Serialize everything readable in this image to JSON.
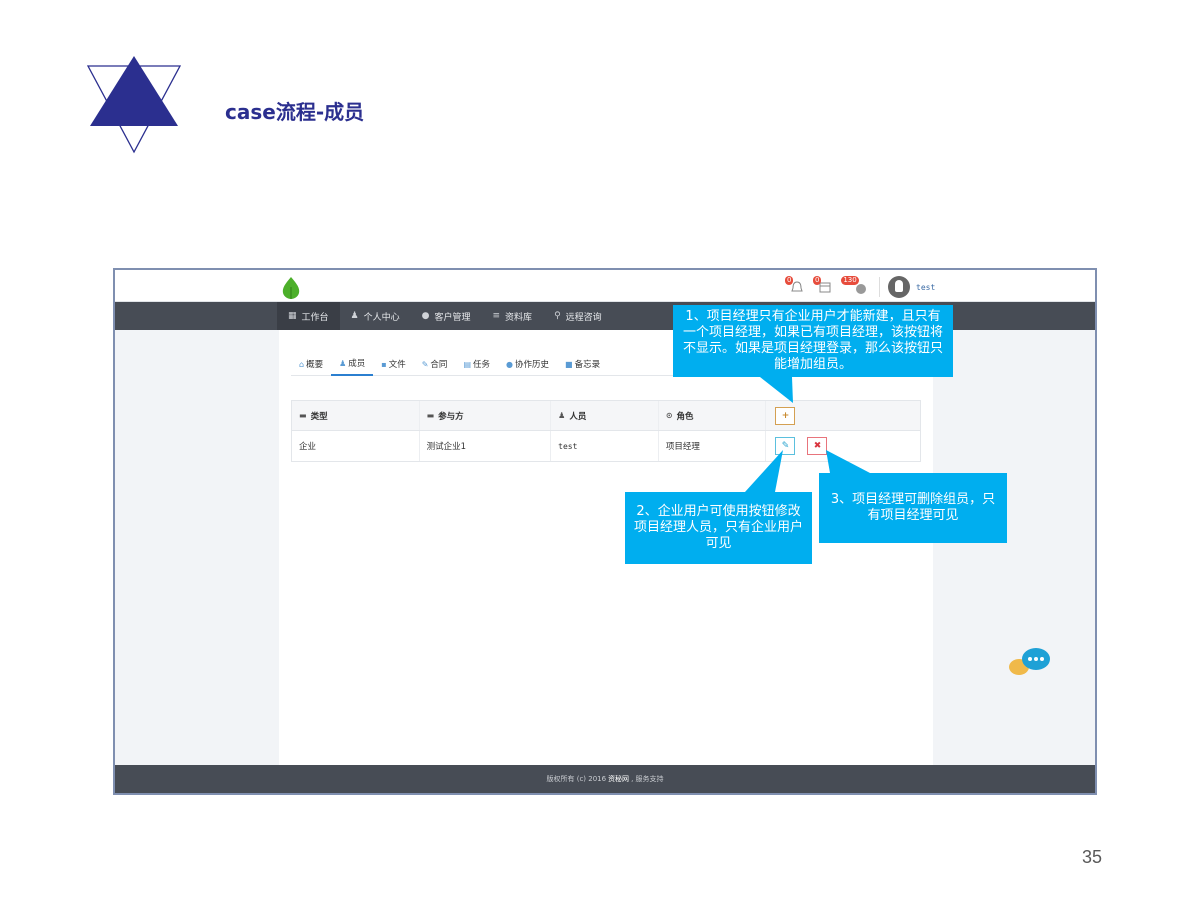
{
  "slide": {
    "title": "case流程-成员",
    "page_number": "35",
    "accent_color": "#2b2f8f"
  },
  "app": {
    "badges": {
      "notifications": "0",
      "tasks": "0",
      "messages": "130"
    },
    "username": "test",
    "nav": [
      {
        "label": "工作台",
        "icon": "grid-icon"
      },
      {
        "label": "个人中心",
        "icon": "user-icon"
      },
      {
        "label": "客户管理",
        "icon": "chat-icon"
      },
      {
        "label": "资料库",
        "icon": "database-icon"
      },
      {
        "label": "远程咨询",
        "icon": "person-icon"
      }
    ],
    "tabs": [
      {
        "label": "概要",
        "icon": "home-icon"
      },
      {
        "label": "成员",
        "icon": "user-icon"
      },
      {
        "label": "文件",
        "icon": "file-icon"
      },
      {
        "label": "合同",
        "icon": "paperclip-icon"
      },
      {
        "label": "任务",
        "icon": "calendar-icon"
      },
      {
        "label": "协作历史",
        "icon": "chat-icon"
      },
      {
        "label": "备忘录",
        "icon": "book-icon"
      }
    ],
    "table": {
      "headers": [
        "类型",
        "参与方",
        "人员",
        "角色"
      ],
      "rows": [
        {
          "type": "企业",
          "party": "测试企业1",
          "person": "test",
          "role": "项目经理"
        }
      ],
      "add_button": "+",
      "edit_button": "✎",
      "delete_button": "✖"
    },
    "footer": {
      "prefix": "版权所有 (c) 2016",
      "brand": "资秘网",
      "suffix": ", 服务支持"
    }
  },
  "callouts": {
    "create_rule": "1、项目经理只有企业用户才能新建，且只有一个项目经理，如果已有项目经理，该按钮将不显示。如果是项目经理登录，那么该按钮只能增加组员。",
    "edit_rule": "2、企业用户可使用按钮修改项目经理人员，只有企业用户可见",
    "delete_rule": "3、项目经理可删除组员，只有项目经理可见",
    "color": "#00aeef"
  }
}
